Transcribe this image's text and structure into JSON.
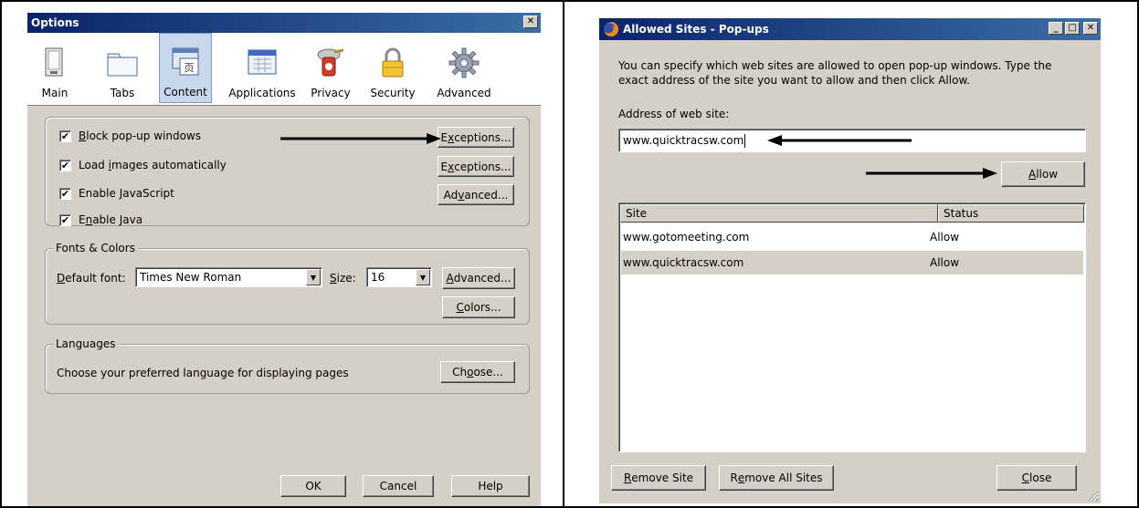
{
  "options": {
    "title": "Options",
    "close_glyph": "✕",
    "tabs": [
      {
        "label": "Main",
        "icon": "main-icon"
      },
      {
        "label": "Tabs",
        "icon": "tabs-icon"
      },
      {
        "label": "Content",
        "icon": "content-icon",
        "selected": true
      },
      {
        "label": "Applications",
        "icon": "applications-icon"
      },
      {
        "label": "Privacy",
        "icon": "privacy-icon"
      },
      {
        "label": "Security",
        "icon": "security-icon"
      },
      {
        "label": "Advanced",
        "icon": "advanced-icon"
      }
    ],
    "content": {
      "block_popups": {
        "pre": "",
        "key": "B",
        "post": "lock pop-up windows",
        "checked": true
      },
      "load_images": {
        "pre": "Load ",
        "key": "i",
        "post": "mages automatically",
        "checked": true
      },
      "enable_js": {
        "pre": "Enable ",
        "key": "J",
        "post": "avaScript",
        "checked": true
      },
      "enable_java": {
        "pre": "E",
        "key": "n",
        "post": "able Java",
        "checked": true
      },
      "exceptions1": {
        "pre": "E",
        "key": "x",
        "post": "ceptions..."
      },
      "exceptions2": {
        "pre": "E",
        "key": "x",
        "post": "ceptions..."
      },
      "advanced_js": {
        "pre": "Ad",
        "key": "v",
        "post": "anced..."
      },
      "check_glyph": "✔"
    },
    "fonts": {
      "legend": "Fonts & Colors",
      "default_font_label_key": "D",
      "default_font_label_rest": "efault font:",
      "default_font_value": "Times New Roman",
      "size_label_key": "S",
      "size_label_rest": "ize:",
      "size_value": "16",
      "advanced_pre": "",
      "advanced_key": "A",
      "advanced_post": "dvanced...",
      "colors_pre": "",
      "colors_key": "C",
      "colors_post": "olors..."
    },
    "languages": {
      "legend": "Languages",
      "description": "Choose your preferred language for displaying pages",
      "choose_pre": "Ch",
      "choose_key": "o",
      "choose_post": "ose..."
    },
    "footer": {
      "ok": "OK",
      "cancel": "Cancel",
      "help": "Help"
    }
  },
  "allowed": {
    "title": "Allowed Sites - Pop-ups",
    "min_glyph": "_",
    "max_glyph": "□",
    "close_glyph": "✕",
    "description": "You can specify which web sites are allowed to open pop-up windows. Type the exact address of the site you want to allow and then click Allow.",
    "address_label": "Address of web site:",
    "address_value": "www.quicktracsw.com",
    "allow_key": "A",
    "allow_rest": "llow",
    "columns": {
      "site": "Site",
      "status": "Status"
    },
    "rows": [
      {
        "site": "www.gotomeeting.com",
        "status": "Allow"
      },
      {
        "site": "www.quicktracsw.com",
        "status": "Allow"
      }
    ],
    "remove_site_key": "R",
    "remove_site_rest": "emove Site",
    "remove_all_pre": "R",
    "remove_all_key": "e",
    "remove_all_rest": "move All Sites",
    "close_key": "C",
    "close_rest": "lose"
  }
}
